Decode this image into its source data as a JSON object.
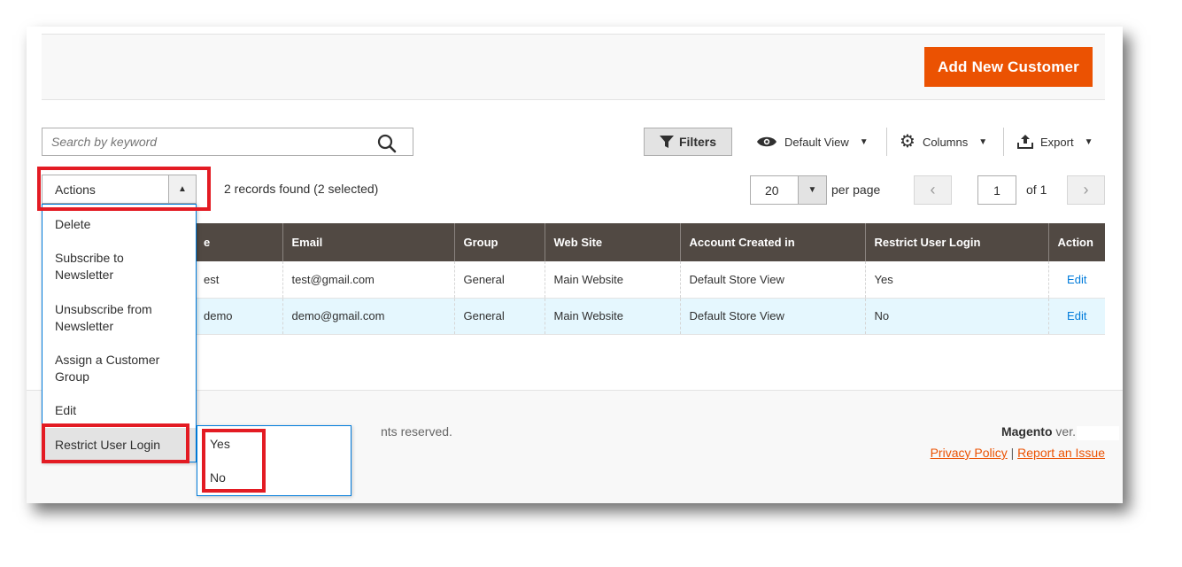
{
  "page_actions": {
    "add_new_label": "Add New Customer"
  },
  "search": {
    "placeholder": "Search by keyword"
  },
  "toolbar": {
    "filters_label": "Filters",
    "view_label": "Default View",
    "columns_label": "Columns",
    "export_label": "Export"
  },
  "mass_actions": {
    "label": "Actions",
    "records_text": "2 records found (2 selected)",
    "items": [
      {
        "label": "Delete"
      },
      {
        "label": "Subscribe to Newsletter"
      },
      {
        "label": "Unsubscribe from Newsletter"
      },
      {
        "label": "Assign a Customer Group"
      },
      {
        "label": "Edit"
      },
      {
        "label": "Restrict User Login"
      }
    ],
    "submenu": [
      {
        "label": "Yes"
      },
      {
        "label": "No"
      }
    ]
  },
  "pager": {
    "per_page_value": "20",
    "per_page_label": "per page",
    "current_page": "1",
    "total_label": "of 1"
  },
  "grid": {
    "columns": [
      "e",
      "Email",
      "Group",
      "Web Site",
      "Account Created in",
      "Restrict User Login",
      "Action"
    ],
    "rows": [
      {
        "name": "est",
        "email": "test@gmail.com",
        "group": "General",
        "website": "Main Website",
        "created_in": "Default Store View",
        "restrict": "Yes",
        "action": "Edit"
      },
      {
        "name": "demo",
        "email": "demo@gmail.com",
        "group": "General",
        "website": "Main Website",
        "created_in": "Default Store View",
        "restrict": "No",
        "action": "Edit"
      }
    ]
  },
  "footer": {
    "copyright_fragment": "nts reserved.",
    "brand": "Magento",
    "version_prefix": "ver.",
    "privacy_label": "Privacy Policy",
    "separator": "|",
    "report_label": "Report an Issue"
  },
  "colors": {
    "accent": "#eb5202",
    "header_bg": "#514943",
    "selected_row": "#e5f7fe",
    "link": "#007bdb",
    "highlight": "#e31b23"
  }
}
